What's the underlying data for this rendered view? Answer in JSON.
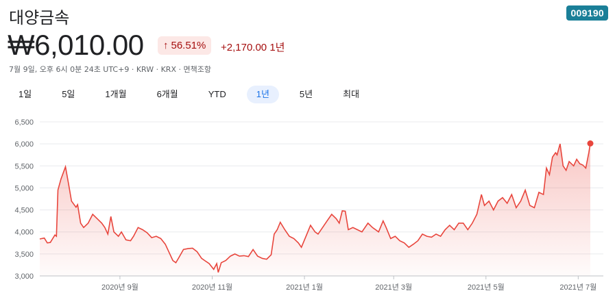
{
  "header": {
    "name": "대양금속",
    "ticker": "009190",
    "price": "₩6,010.00",
    "change_pct": "56.51%",
    "change_abs": "+2,170.00 1년",
    "meta": "7월 9일, 오후 6시 0분 24초 UTC+9 · KRW · KRX · 면책조항"
  },
  "tabs": [
    {
      "label": "1일",
      "active": false
    },
    {
      "label": "5일",
      "active": false
    },
    {
      "label": "1개월",
      "active": false
    },
    {
      "label": "6개월",
      "active": false
    },
    {
      "label": "YTD",
      "active": false
    },
    {
      "label": "1년",
      "active": true
    },
    {
      "label": "5년",
      "active": false
    },
    {
      "label": "최대",
      "active": false
    }
  ],
  "colors": {
    "line": "#e8453c",
    "accent": "#1a73e8",
    "down": "#a50e0e"
  },
  "chart_data": {
    "type": "area",
    "x_range": [
      "2020-07-10",
      "2021-07-09"
    ],
    "ylim": [
      3000,
      6500
    ],
    "yticks": [
      "3,000",
      "3,500",
      "4,000",
      "4,500",
      "5,000",
      "5,500",
      "6,000",
      "6,500"
    ],
    "ytick_values": [
      3000,
      3500,
      4000,
      4500,
      5000,
      5500,
      6000,
      6500
    ],
    "xticks": [
      {
        "label": "2020년 9월",
        "date": "2020-09-01"
      },
      {
        "label": "2020년 11월",
        "date": "2020-11-01"
      },
      {
        "label": "2021년 1월",
        "date": "2021-01-01"
      },
      {
        "label": "2021년 3월",
        "date": "2021-03-01"
      },
      {
        "label": "2021년 5월",
        "date": "2021-05-01"
      },
      {
        "label": "2021년 7월",
        "date": "2021-07-01"
      }
    ],
    "grid": true,
    "series": [
      {
        "points": [
          [
            "2020-07-10",
            3840
          ],
          [
            "2020-07-13",
            3860
          ],
          [
            "2020-07-15",
            3750
          ],
          [
            "2020-07-17",
            3760
          ],
          [
            "2020-07-20",
            3930
          ],
          [
            "2020-07-21",
            3900
          ],
          [
            "2020-07-22",
            4950
          ],
          [
            "2020-07-24",
            5200
          ],
          [
            "2020-07-27",
            5480
          ],
          [
            "2020-07-29",
            5100
          ],
          [
            "2020-07-31",
            4700
          ],
          [
            "2020-08-03",
            4560
          ],
          [
            "2020-08-04",
            4620
          ],
          [
            "2020-08-06",
            4200
          ],
          [
            "2020-08-08",
            4100
          ],
          [
            "2020-08-11",
            4200
          ],
          [
            "2020-08-14",
            4400
          ],
          [
            "2020-08-17",
            4300
          ],
          [
            "2020-08-20",
            4200
          ],
          [
            "2020-08-22",
            4100
          ],
          [
            "2020-08-24",
            3950
          ],
          [
            "2020-08-26",
            4350
          ],
          [
            "2020-08-28",
            4000
          ],
          [
            "2020-08-31",
            3900
          ],
          [
            "2020-09-02",
            4000
          ],
          [
            "2020-09-05",
            3820
          ],
          [
            "2020-09-08",
            3800
          ],
          [
            "2020-09-10",
            3900
          ],
          [
            "2020-09-13",
            4100
          ],
          [
            "2020-09-16",
            4050
          ],
          [
            "2020-09-19",
            3980
          ],
          [
            "2020-09-22",
            3870
          ],
          [
            "2020-09-25",
            3900
          ],
          [
            "2020-09-28",
            3850
          ],
          [
            "2020-10-01",
            3720
          ],
          [
            "2020-10-04",
            3500
          ],
          [
            "2020-10-06",
            3350
          ],
          [
            "2020-10-08",
            3300
          ],
          [
            "2020-10-10",
            3420
          ],
          [
            "2020-10-13",
            3600
          ],
          [
            "2020-10-16",
            3620
          ],
          [
            "2020-10-19",
            3630
          ],
          [
            "2020-10-22",
            3550
          ],
          [
            "2020-10-25",
            3400
          ],
          [
            "2020-10-27",
            3350
          ],
          [
            "2020-10-30",
            3280
          ],
          [
            "2020-11-02",
            3150
          ],
          [
            "2020-11-04",
            3280
          ],
          [
            "2020-11-05",
            3080
          ],
          [
            "2020-11-07",
            3300
          ],
          [
            "2020-11-10",
            3350
          ],
          [
            "2020-11-13",
            3450
          ],
          [
            "2020-11-16",
            3500
          ],
          [
            "2020-11-19",
            3450
          ],
          [
            "2020-11-22",
            3460
          ],
          [
            "2020-11-25",
            3440
          ],
          [
            "2020-11-28",
            3600
          ],
          [
            "2020-12-01",
            3450
          ],
          [
            "2020-12-04",
            3400
          ],
          [
            "2020-12-07",
            3380
          ],
          [
            "2020-12-10",
            3480
          ],
          [
            "2020-12-12",
            3950
          ],
          [
            "2020-12-14",
            4050
          ],
          [
            "2020-12-16",
            4220
          ],
          [
            "2020-12-19",
            4050
          ],
          [
            "2020-12-22",
            3900
          ],
          [
            "2020-12-25",
            3850
          ],
          [
            "2020-12-28",
            3750
          ],
          [
            "2020-12-30",
            3650
          ],
          [
            "2021-01-02",
            3900
          ],
          [
            "2021-01-05",
            4150
          ],
          [
            "2021-01-08",
            4000
          ],
          [
            "2021-01-10",
            3950
          ],
          [
            "2021-01-13",
            4100
          ],
          [
            "2021-01-16",
            4250
          ],
          [
            "2021-01-19",
            4400
          ],
          [
            "2021-01-22",
            4300
          ],
          [
            "2021-01-24",
            4200
          ],
          [
            "2021-01-26",
            4480
          ],
          [
            "2021-01-28",
            4470
          ],
          [
            "2021-01-30",
            4050
          ],
          [
            "2021-02-02",
            4100
          ],
          [
            "2021-02-05",
            4050
          ],
          [
            "2021-02-08",
            4000
          ],
          [
            "2021-02-12",
            4200
          ],
          [
            "2021-02-15",
            4100
          ],
          [
            "2021-02-19",
            4000
          ],
          [
            "2021-02-22",
            4250
          ],
          [
            "2021-02-24",
            4100
          ],
          [
            "2021-02-27",
            3850
          ],
          [
            "2021-03-02",
            3900
          ],
          [
            "2021-03-05",
            3800
          ],
          [
            "2021-03-08",
            3750
          ],
          [
            "2021-03-11",
            3650
          ],
          [
            "2021-03-14",
            3720
          ],
          [
            "2021-03-17",
            3800
          ],
          [
            "2021-03-20",
            3950
          ],
          [
            "2021-03-23",
            3900
          ],
          [
            "2021-03-26",
            3880
          ],
          [
            "2021-03-29",
            3950
          ],
          [
            "2021-04-01",
            3900
          ],
          [
            "2021-04-04",
            4050
          ],
          [
            "2021-04-07",
            4150
          ],
          [
            "2021-04-10",
            4050
          ],
          [
            "2021-04-13",
            4200
          ],
          [
            "2021-04-16",
            4200
          ],
          [
            "2021-04-19",
            4050
          ],
          [
            "2021-04-22",
            4200
          ],
          [
            "2021-04-25",
            4400
          ],
          [
            "2021-04-28",
            4850
          ],
          [
            "2021-04-30",
            4600
          ],
          [
            "2021-05-03",
            4700
          ],
          [
            "2021-05-06",
            4500
          ],
          [
            "2021-05-09",
            4700
          ],
          [
            "2021-05-12",
            4780
          ],
          [
            "2021-05-15",
            4650
          ],
          [
            "2021-05-18",
            4850
          ],
          [
            "2021-05-21",
            4550
          ],
          [
            "2021-05-24",
            4700
          ],
          [
            "2021-05-27",
            4950
          ],
          [
            "2021-05-30",
            4600
          ],
          [
            "2021-06-02",
            4550
          ],
          [
            "2021-06-05",
            4900
          ],
          [
            "2021-06-08",
            4850
          ],
          [
            "2021-06-10",
            5450
          ],
          [
            "2021-06-12",
            5300
          ],
          [
            "2021-06-14",
            5700
          ],
          [
            "2021-06-16",
            5800
          ],
          [
            "2021-06-17",
            5750
          ],
          [
            "2021-06-19",
            6000
          ],
          [
            "2021-06-21",
            5500
          ],
          [
            "2021-06-23",
            5400
          ],
          [
            "2021-06-25",
            5600
          ],
          [
            "2021-06-28",
            5500
          ],
          [
            "2021-06-30",
            5650
          ],
          [
            "2021-07-02",
            5550
          ],
          [
            "2021-07-04",
            5520
          ],
          [
            "2021-07-06",
            5450
          ],
          [
            "2021-07-08",
            5800
          ],
          [
            "2021-07-09",
            6010
          ]
        ]
      }
    ]
  }
}
